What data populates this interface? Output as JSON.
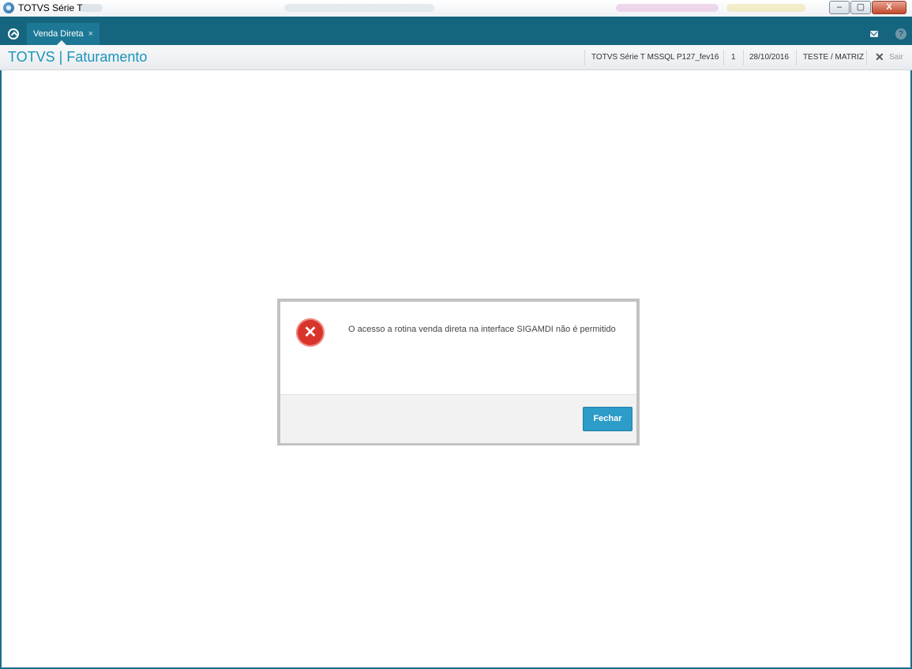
{
  "window": {
    "title": "TOTVS Série T",
    "minimize": "–",
    "maximize": "▢",
    "close": "X"
  },
  "tabs": [
    {
      "label": "Venda Direta",
      "close": "×"
    }
  ],
  "header": {
    "brand": "TOTVS | Faturamento",
    "environment": "TOTVS Série T  MSSQL P127_fev16",
    "company_code": "1",
    "date": "28/10/2016",
    "user_branch": "TESTE / MATRIZ",
    "exit_label": "Sair"
  },
  "dialog": {
    "message": "O acesso a rotina venda direta na interface SIGAMDI não é permitido",
    "button_label": "Fechar"
  },
  "colors": {
    "accent": "#16657f",
    "brand": "#1b94ba",
    "error": "#d9342b",
    "button": "#2c9cc9"
  },
  "icons": [
    "app-logo-icon",
    "home-icon",
    "mail-icon",
    "help-icon",
    "close-x-icon",
    "error-icon"
  ]
}
